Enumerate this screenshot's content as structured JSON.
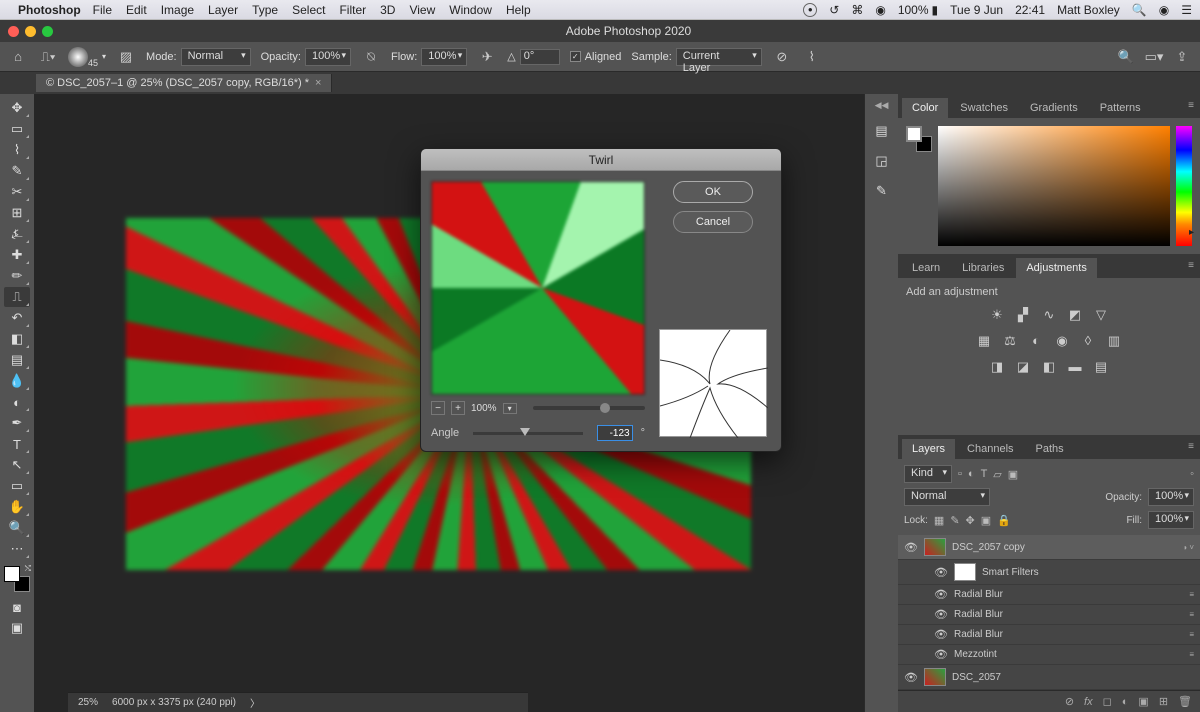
{
  "menubar": {
    "appname": "Photoshop",
    "items": [
      "File",
      "Edit",
      "Image",
      "Layer",
      "Type",
      "Select",
      "Filter",
      "3D",
      "View",
      "Window",
      "Help"
    ],
    "right": {
      "battery": "100%",
      "date": "Tue 9 Jun",
      "time": "22:41",
      "user": "Matt Boxley"
    }
  },
  "titlebar": {
    "title": "Adobe Photoshop 2020"
  },
  "optionsbar": {
    "brush_size": "45",
    "mode_label": "Mode:",
    "mode_value": "Normal",
    "opacity_label": "Opacity:",
    "opacity_value": "100%",
    "flow_label": "Flow:",
    "flow_value": "100%",
    "angle_label": "",
    "angle_value": "0°",
    "aligned_label": "Aligned",
    "sample_label": "Sample:",
    "sample_value": "Current Layer"
  },
  "doctab": {
    "label": "© DSC_2057–1 @ 25% (DSC_2057 copy, RGB/16*) *"
  },
  "tools": [
    {
      "name": "move-tool",
      "glyph": "✥"
    },
    {
      "name": "marquee-tool",
      "glyph": "▭"
    },
    {
      "name": "lasso-tool",
      "glyph": "⌇"
    },
    {
      "name": "quick-select-tool",
      "glyph": "✎"
    },
    {
      "name": "crop-tool",
      "glyph": "✂"
    },
    {
      "name": "frame-tool",
      "glyph": "⊞"
    },
    {
      "name": "eyedropper-tool",
      "glyph": "⍼"
    },
    {
      "name": "healing-tool",
      "glyph": "✚"
    },
    {
      "name": "brush-tool",
      "glyph": "✏"
    },
    {
      "name": "stamp-tool",
      "glyph": "⎍",
      "active": true
    },
    {
      "name": "history-brush-tool",
      "glyph": "↶"
    },
    {
      "name": "eraser-tool",
      "glyph": "◧"
    },
    {
      "name": "gradient-tool",
      "glyph": "▤"
    },
    {
      "name": "blur-tool",
      "glyph": "💧"
    },
    {
      "name": "dodge-tool",
      "glyph": "◐"
    },
    {
      "name": "pen-tool",
      "glyph": "✒"
    },
    {
      "name": "type-tool",
      "glyph": "T"
    },
    {
      "name": "path-select-tool",
      "glyph": "↖"
    },
    {
      "name": "shape-tool",
      "glyph": "▭"
    },
    {
      "name": "hand-tool",
      "glyph": "✋"
    },
    {
      "name": "zoom-tool",
      "glyph": "🔍"
    },
    {
      "name": "edit-toolbar",
      "glyph": "⋯"
    }
  ],
  "color_panel": {
    "tabs": [
      "Color",
      "Swatches",
      "Gradients",
      "Patterns"
    ],
    "active": 0
  },
  "props_panel": {
    "tabs": [
      "Learn",
      "Libraries",
      "Adjustments"
    ],
    "active": 2,
    "label": "Add an adjustment"
  },
  "layers_panel": {
    "tabs": [
      "Layers",
      "Channels",
      "Paths"
    ],
    "active": 0,
    "kind_label": "Kind",
    "blend_mode": "Normal",
    "opacity_label": "Opacity:",
    "opacity_value": "100%",
    "lock_label": "Lock:",
    "fill_label": "Fill:",
    "fill_value": "100%",
    "layers": [
      {
        "name": "DSC_2057 copy",
        "selected": true,
        "thumb": "img"
      },
      {
        "name": "Smart Filters",
        "smartlabel": true,
        "thumb": "white"
      },
      {
        "name": "Radial Blur",
        "sub": true
      },
      {
        "name": "Radial Blur",
        "sub": true
      },
      {
        "name": "Radial Blur",
        "sub": true
      },
      {
        "name": "Mezzotint",
        "sub": true
      },
      {
        "name": "DSC_2057",
        "thumb": "img"
      }
    ]
  },
  "statusbar": {
    "zoom": "25%",
    "info": "6000 px x 3375 px (240 ppi)"
  },
  "dialog": {
    "title": "Twirl",
    "ok": "OK",
    "cancel": "Cancel",
    "zoom": "100%",
    "angle_label": "Angle",
    "angle_value": "-123",
    "angle_unit": "°"
  }
}
